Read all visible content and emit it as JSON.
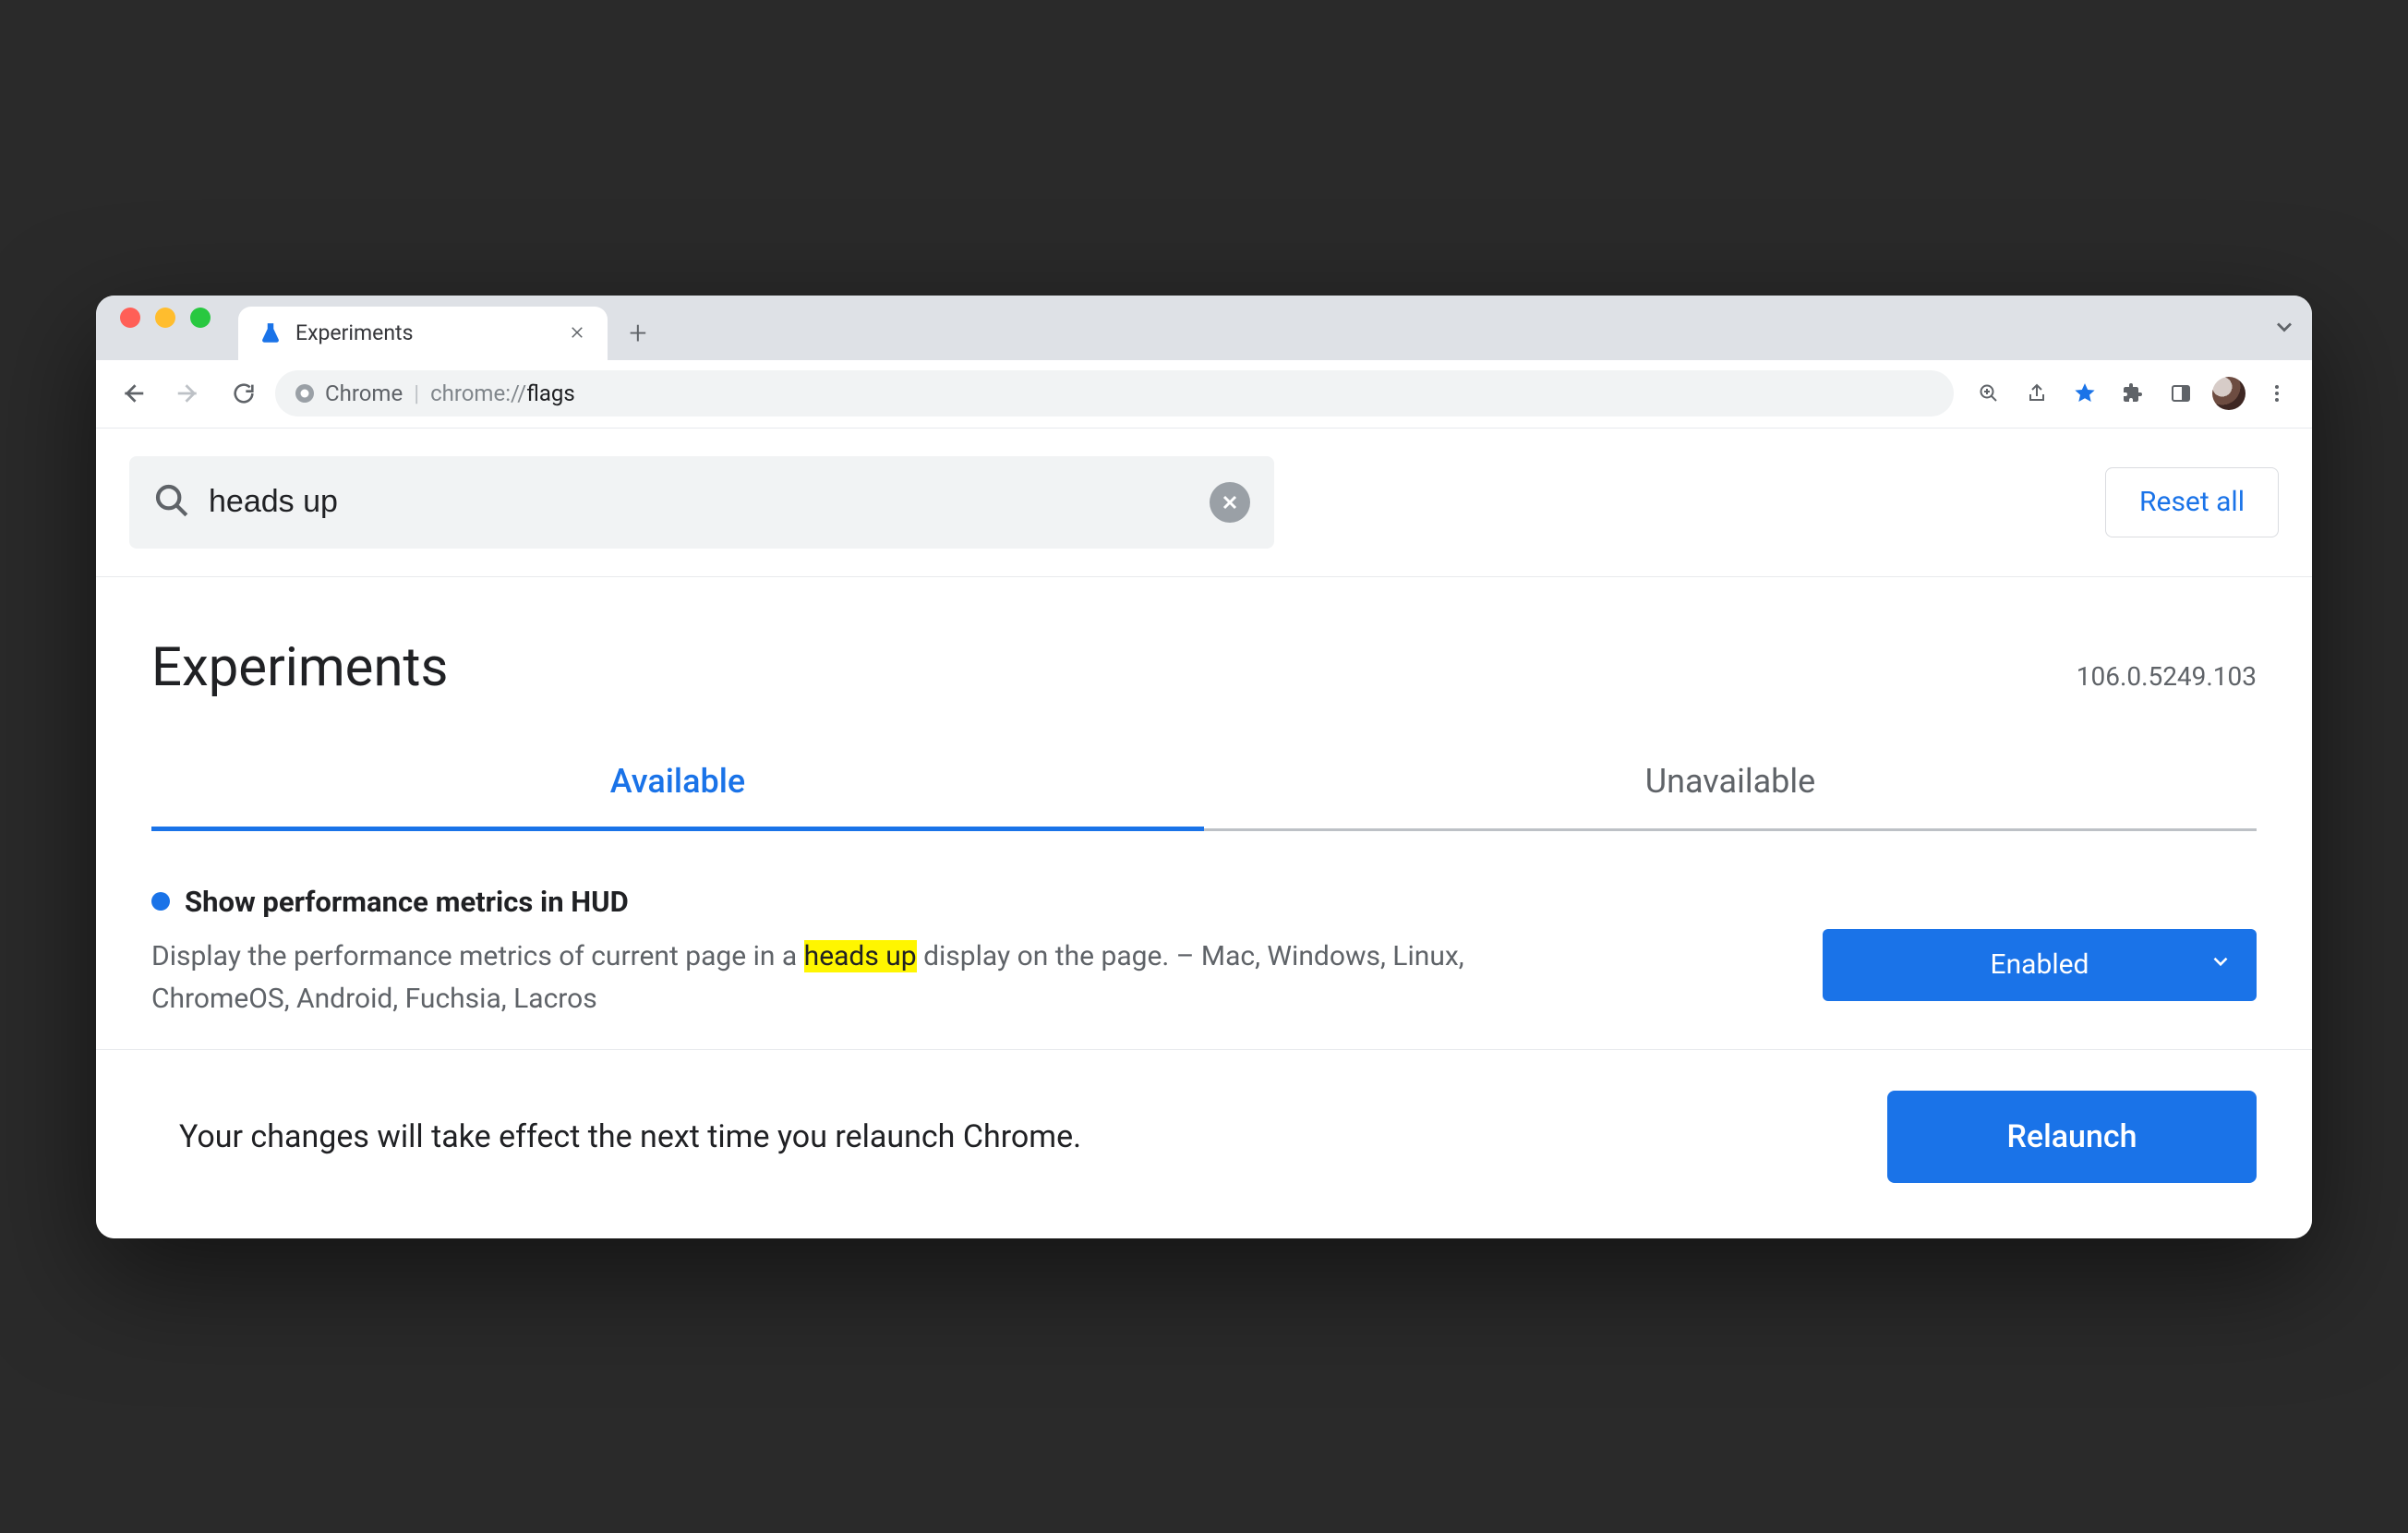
{
  "browser": {
    "tab_title": "Experiments",
    "url_scheme_host": "chrome://",
    "url_label": "Chrome",
    "url_path": "flags"
  },
  "search": {
    "value": "heads up",
    "reset_label": "Reset all"
  },
  "heading": {
    "title": "Experiments",
    "version": "106.0.5249.103"
  },
  "tabs": {
    "available": "Available",
    "unavailable": "Unavailable"
  },
  "flag": {
    "title": "Show performance metrics in HUD",
    "desc_before": "Display the performance metrics of current page in a ",
    "desc_highlight": "heads up",
    "desc_after": " display on the page. – Mac, Windows, Linux, ChromeOS, Android, Fuchsia, Lacros",
    "select_value": "Enabled"
  },
  "relaunch": {
    "message": "Your changes will take effect the next time you relaunch Chrome.",
    "button": "Relaunch"
  }
}
